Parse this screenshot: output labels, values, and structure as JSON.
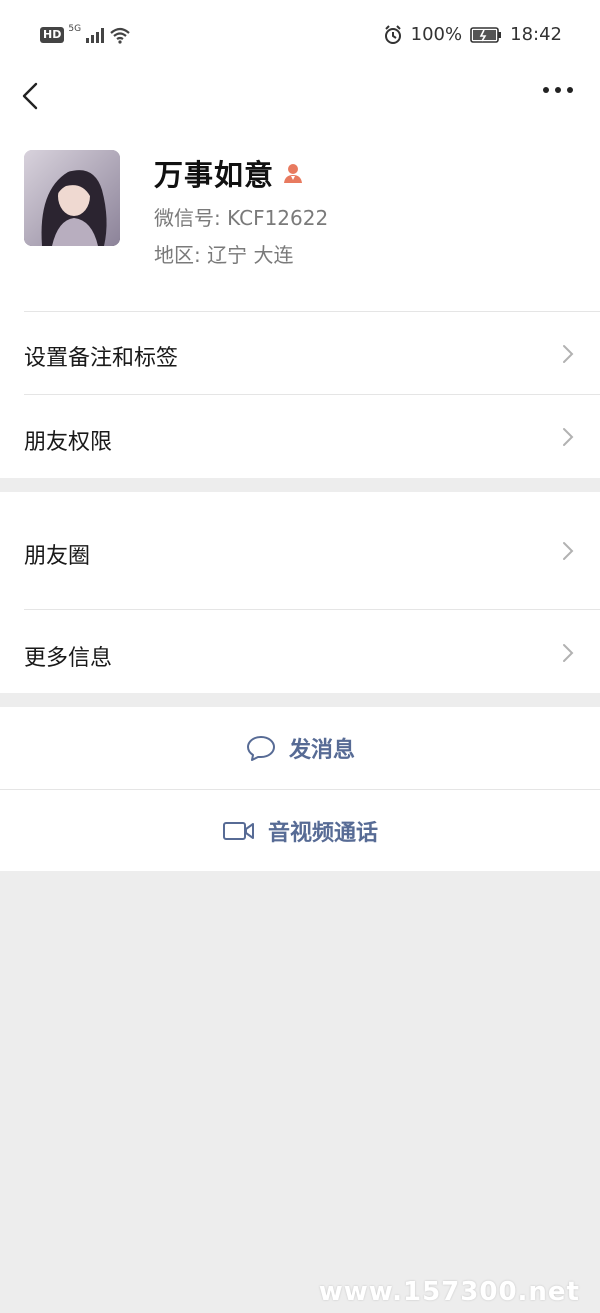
{
  "status_bar": {
    "hd": "HD",
    "network": "5G",
    "battery": "100%",
    "time": "18:42"
  },
  "profile": {
    "name": "万事如意",
    "wechat_id": "微信号: KCF12622",
    "region": "地区: 辽宁  大连"
  },
  "settings": {
    "remark_tags": "设置备注和标签",
    "friend_permissions": "朋友权限",
    "moments": "朋友圈",
    "more_info": "更多信息"
  },
  "actions": {
    "send_message": "发消息",
    "video_call": "音视频通话"
  },
  "watermark": "www.157300.net",
  "colors": {
    "link": "#576b95",
    "background": "#ededed",
    "gender_female": "#e87a5f"
  },
  "icons": {
    "back": "back-arrow-icon",
    "more": "more-dots-icon",
    "chevron": "chevron-right-icon",
    "message": "chat-bubble-icon",
    "video": "video-camera-icon",
    "alarm": "alarm-icon",
    "wifi": "wifi-icon",
    "signal": "signal-icon",
    "battery": "battery-icon",
    "gender": "female-user-icon"
  }
}
